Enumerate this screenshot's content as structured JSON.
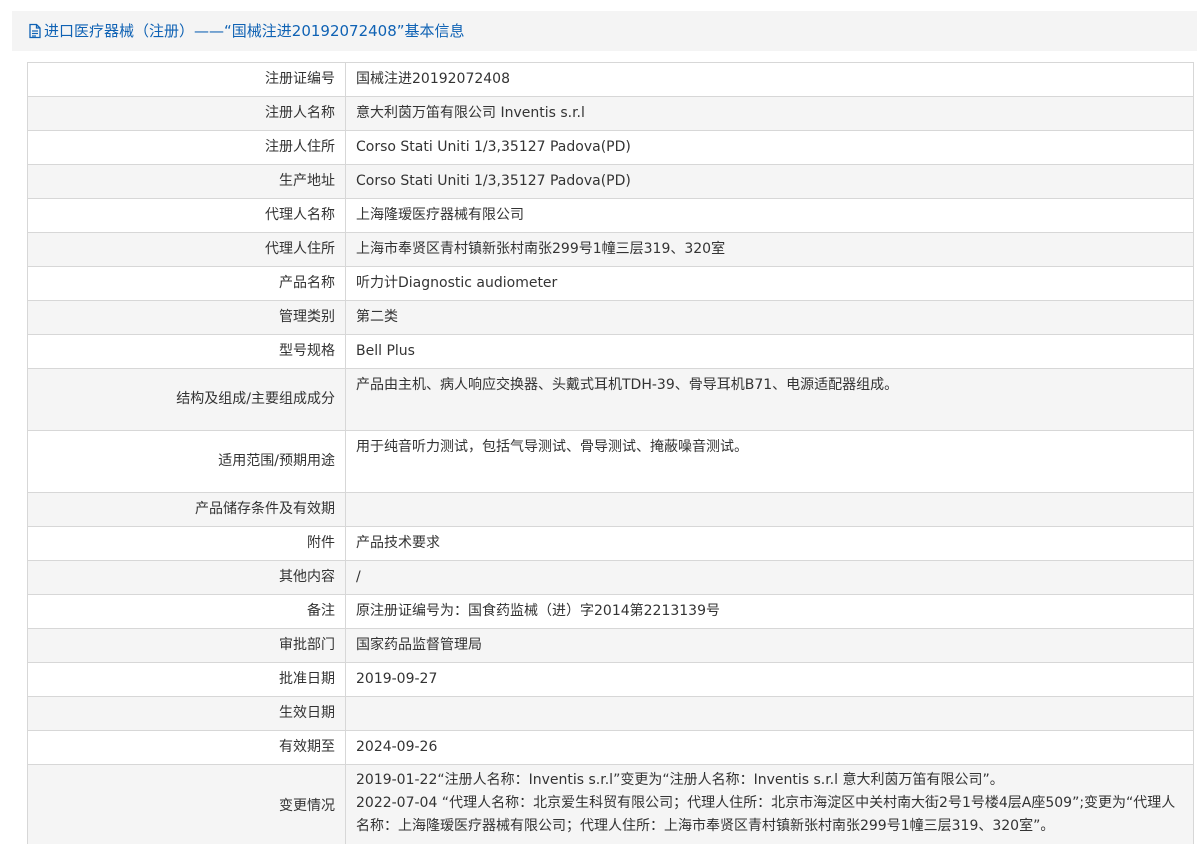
{
  "header": {
    "title": "进口医疗器械（注册）——“国械注进20192072408”基本信息",
    "icon": "document-icon"
  },
  "rows": [
    {
      "label": "注册证编号",
      "value": "国械注进20192072408"
    },
    {
      "label": "注册人名称",
      "value": "意大利茵万笛有限公司 Inventis s.r.l"
    },
    {
      "label": "注册人住所",
      "value": "Corso Stati Uniti 1/3,35127 Padova(PD)"
    },
    {
      "label": "生产地址",
      "value": "Corso Stati Uniti 1/3,35127 Padova(PD)"
    },
    {
      "label": "代理人名称",
      "value": "上海隆瑷医疗器械有限公司"
    },
    {
      "label": "代理人住所",
      "value": "上海市奉贤区青村镇新张村南张299号1幢三层319、320室"
    },
    {
      "label": "产品名称",
      "value": "听力计Diagnostic audiometer"
    },
    {
      "label": "管理类别",
      "value": "第二类"
    },
    {
      "label": "型号规格",
      "value": "Bell Plus"
    },
    {
      "label": "结构及组成/主要组成成分",
      "value": "产品由主机、病人响应交换器、头戴式耳机TDH-39、骨导耳机B71、电源适配器组成。"
    },
    {
      "label": "适用范围/预期用途",
      "value": "用于纯音听力测试，包括气导测试、骨导测试、掩蔽噪音测试。"
    },
    {
      "label": "产品储存条件及有效期",
      "value": ""
    },
    {
      "label": "附件",
      "value": "产品技术要求"
    },
    {
      "label": "其他内容",
      "value": "/"
    },
    {
      "label": "备注",
      "value": "原注册证编号为：国食药监械（进）字2014第2213139号"
    },
    {
      "label": "审批部门",
      "value": "国家药品监督管理局"
    },
    {
      "label": "批准日期",
      "value": "2019-09-27"
    },
    {
      "label": "生效日期",
      "value": ""
    },
    {
      "label": "有效期至",
      "value": "2024-09-26"
    },
    {
      "label": "变更情况",
      "value_lines": [
        "2019-01-22“注册人名称：Inventis s.r.l”变更为“注册人名称：Inventis s.r.l 意大利茵万笛有限公司”。",
        "2022-07-04 “代理人名称：北京爱生科贸有限公司；代理人住所：北京市海淀区中关村南大街2号1号楼4层A座509”;变更为“代理人名称：上海隆瑷医疗器械有限公司；代理人住所：上海市奉贤区青村镇新张村南张299号1幢三层319、320室”。"
      ]
    },
    {
      "label": "",
      "value": ""
    }
  ],
  "colors": {
    "title": "#0f62b4",
    "border": "#d7d7d7",
    "alt_row": "#f5f5f5",
    "frame": "#f4f4f4"
  }
}
